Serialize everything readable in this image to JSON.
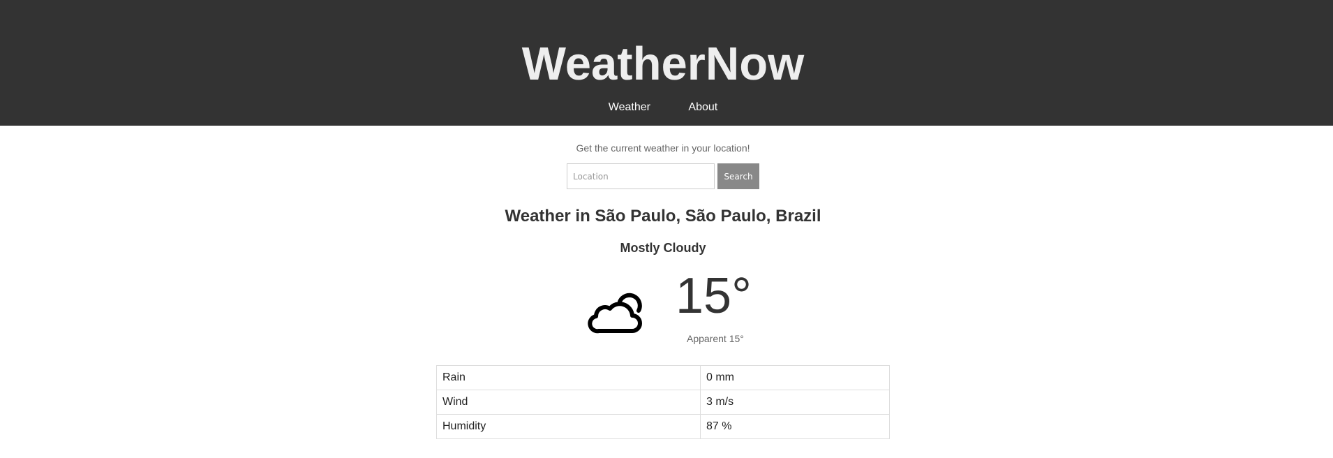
{
  "header": {
    "title": "WeatherNow",
    "nav": [
      {
        "label": "Weather"
      },
      {
        "label": "About"
      }
    ]
  },
  "main": {
    "tagline": "Get the current weather in your location!",
    "search": {
      "placeholder": "Location",
      "value": "",
      "button_label": "Search"
    },
    "location_heading": "Weather in São Paulo, São Paulo, Brazil",
    "condition": "Mostly Cloudy",
    "icon": "cloud-icon",
    "temperature": "15°",
    "apparent": "Apparent 15°",
    "details": [
      {
        "label": "Rain",
        "value": "0 mm"
      },
      {
        "label": "Wind",
        "value": "3 m/s"
      },
      {
        "label": "Humidity",
        "value": "87 %"
      }
    ]
  },
  "colors": {
    "header_bg": "#333333",
    "title_text": "#eeeeee",
    "button_bg": "#888888",
    "border": "#dddddd"
  }
}
